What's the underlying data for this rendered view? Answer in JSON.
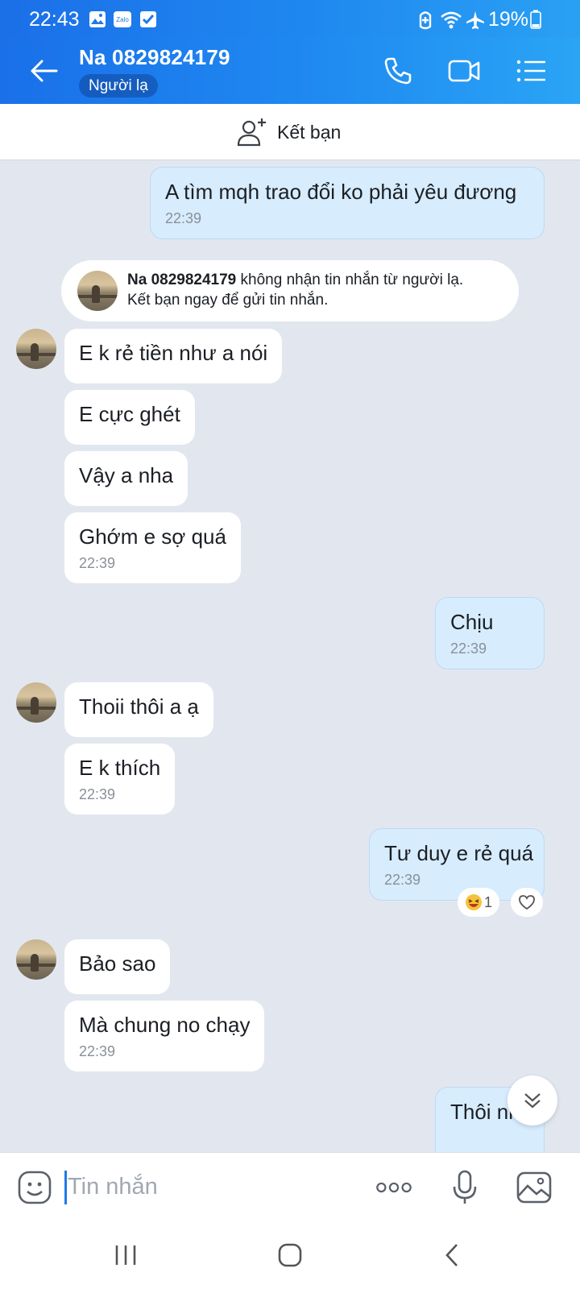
{
  "status_bar": {
    "time": "22:43",
    "notification_icons": [
      "gallery-icon",
      "zalo-icon",
      "checkbox-icon"
    ],
    "system_icons": [
      "battery-saver-icon",
      "wifi-icon",
      "airplane-icon"
    ],
    "battery": "19%"
  },
  "header": {
    "contact_name": "Na 0829824179",
    "badge": "Người lạ",
    "actions": [
      "call-icon",
      "video-call-icon",
      "menu-icon"
    ]
  },
  "friend_bar": {
    "label": "Kết bạn"
  },
  "messages": [
    {
      "dir": "out",
      "text": "A tìm mqh trao đổi ko phải yêu đương",
      "time": "22:39"
    },
    {
      "dir": "in",
      "text": "E k rẻ tiền như a nói"
    },
    {
      "dir": "in",
      "text": "E cực ghét"
    },
    {
      "dir": "in",
      "text": "Vậy a nha"
    },
    {
      "dir": "in",
      "text": "Ghớm e sợ quá",
      "time": "22:39"
    },
    {
      "dir": "out",
      "text": "Chịu",
      "time": "22:39"
    },
    {
      "dir": "in",
      "text": "Thoii thôi a ạ"
    },
    {
      "dir": "in",
      "text": "E k thích",
      "time": "22:39"
    },
    {
      "dir": "out",
      "text": "Tư duy e rẻ quá",
      "time": "22:39",
      "reaction": {
        "emoji": "laughing-emoji",
        "count": "1"
      }
    },
    {
      "dir": "in",
      "text": "Bảo sao"
    },
    {
      "dir": "in",
      "text": "Mà chung no chạy",
      "time": "22:39"
    },
    {
      "dir": "out",
      "text": "Thôi nha"
    }
  ],
  "notice": {
    "name": "Na 0829824179",
    "line1_rest": " không nhận tin nhắn từ người lạ.",
    "line2": "Kết bạn ngay để gửi tin nhắn."
  },
  "input_bar": {
    "placeholder": "Tin nhắn"
  },
  "colors": {
    "header_blue": "#1f8af1",
    "out_bubble": "#d7ecfd",
    "chat_bg": "#e2e7ef"
  }
}
